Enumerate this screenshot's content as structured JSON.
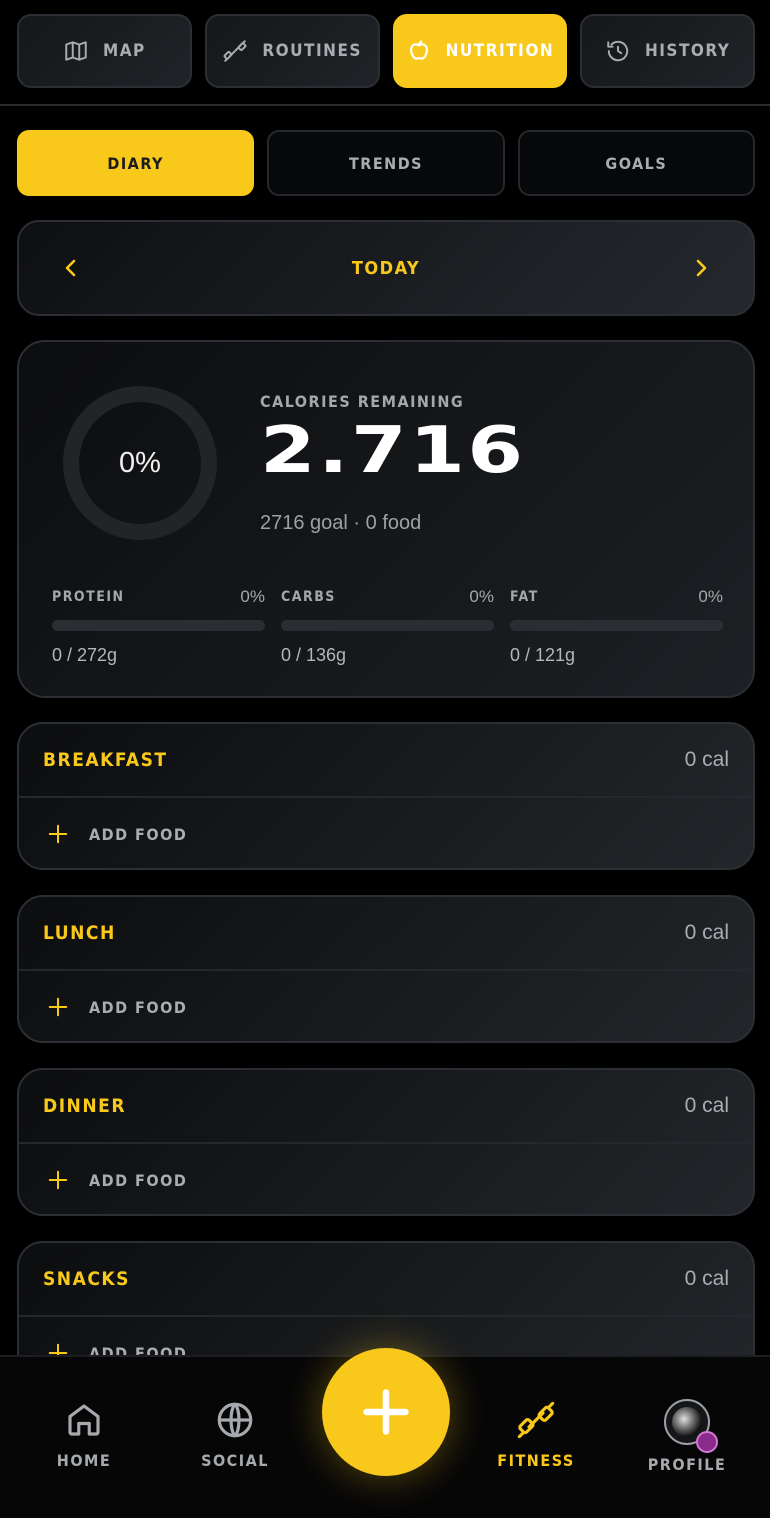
{
  "top_tabs": [
    {
      "label": "MAP",
      "icon": "map-icon",
      "active": false
    },
    {
      "label": "ROUTINES",
      "icon": "dumbbell-icon",
      "active": false
    },
    {
      "label": "NUTRITION",
      "icon": "apple-icon",
      "active": true
    },
    {
      "label": "HISTORY",
      "icon": "history-icon",
      "active": false
    }
  ],
  "sub_tabs": [
    {
      "label": "DIARY",
      "active": true
    },
    {
      "label": "TRENDS",
      "active": false
    },
    {
      "label": "GOALS",
      "active": false
    }
  ],
  "date_nav": {
    "label": "TODAY"
  },
  "calories": {
    "ring_percent": "0%",
    "label": "CALORIES REMAINING",
    "value": "2.716",
    "subtitle": "2716 goal · 0 food"
  },
  "macros": [
    {
      "name": "PROTEIN",
      "percent": "0%",
      "amount": "0 / 272g",
      "fill": 0
    },
    {
      "name": "CARBS",
      "percent": "0%",
      "amount": "0 / 136g",
      "fill": 0
    },
    {
      "name": "FAT",
      "percent": "0%",
      "amount": "0 / 121g",
      "fill": 0
    }
  ],
  "meals": [
    {
      "name": "BREAKFAST",
      "calories": "0 cal",
      "add_label": "ADD FOOD"
    },
    {
      "name": "LUNCH",
      "calories": "0 cal",
      "add_label": "ADD FOOD"
    },
    {
      "name": "DINNER",
      "calories": "0 cal",
      "add_label": "ADD FOOD"
    },
    {
      "name": "SNACKS",
      "calories": "0 cal",
      "add_label": "ADD FOOD"
    }
  ],
  "bottom_nav": [
    {
      "label": "HOME",
      "icon": "home-icon",
      "active": false
    },
    {
      "label": "SOCIAL",
      "icon": "globe-icon",
      "active": false
    },
    {
      "label": "FITNESS",
      "icon": "dumbbell-icon",
      "active": true
    },
    {
      "label": "PROFILE",
      "icon": "avatar",
      "active": false
    }
  ],
  "colors": {
    "accent": "#f8c81b",
    "background": "#000000",
    "card": "#1d2024",
    "muted": "#a9acb0"
  }
}
